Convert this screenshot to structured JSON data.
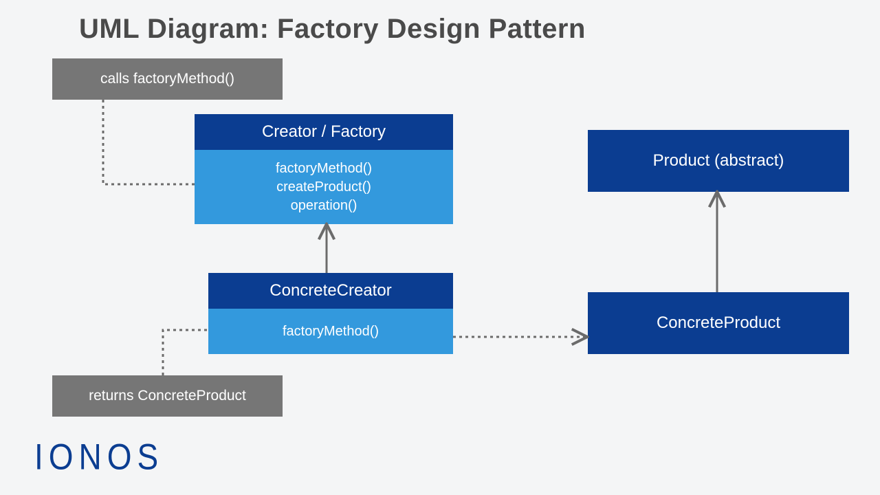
{
  "title": "UML Diagram: Factory Design Pattern",
  "notes": {
    "calls": "calls factoryMethod()",
    "returns": "returns ConcreteProduct"
  },
  "classes": {
    "creator": {
      "name": "Creator / Factory",
      "methods": [
        "factoryMethod()",
        "createProduct()",
        "operation()"
      ]
    },
    "concreteCreator": {
      "name": "ConcreteCreator",
      "methods": [
        "factoryMethod()"
      ]
    },
    "product": {
      "name": "Product (abstract)"
    },
    "concreteProduct": {
      "name": "ConcreteProduct"
    }
  },
  "logo": "IONOS",
  "colors": {
    "bg": "#f4f5f6",
    "noteBg": "#767676",
    "headerBg": "#0b3d91",
    "bodyBg": "#3399dd",
    "arrow": "#6b6b6b",
    "title": "#4a4a4a"
  }
}
